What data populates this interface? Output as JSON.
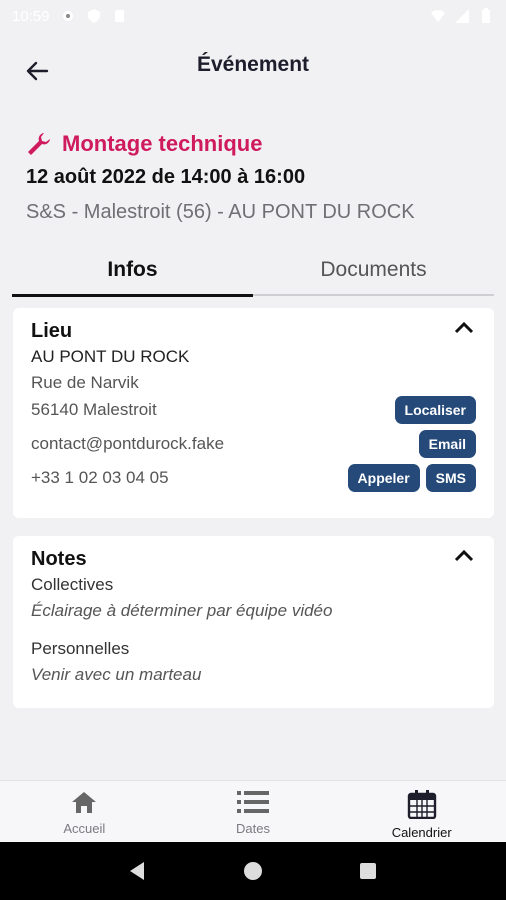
{
  "status_bar": {
    "time": "10:59",
    "icons": [
      "gear-icon",
      "shield-icon",
      "sd-card-icon",
      "wifi-icon",
      "signal-icon",
      "battery-icon"
    ]
  },
  "header": {
    "title": "Événement",
    "back_icon": "arrow-left-icon"
  },
  "event": {
    "type_icon": "wrench-icon",
    "type": "Montage technique",
    "date": "12 août 2022 de 14:00 à 16:00",
    "place": "S&S - Malestroit (56) - AU PONT DU ROCK"
  },
  "tabs": [
    {
      "label": "Infos",
      "active": true
    },
    {
      "label": "Documents",
      "active": false
    }
  ],
  "lieu": {
    "title": "Lieu",
    "name": "AU PONT DU ROCK",
    "street": "Rue de Narvik",
    "city": "56140 Malestroit",
    "email": "contact@pontdurock.fake",
    "phone": "+33 1 02 03 04 05",
    "buttons": {
      "localiser": "Localiser",
      "email": "Email",
      "appeler": "Appeler",
      "sms": "SMS"
    }
  },
  "notes": {
    "title": "Notes",
    "collectives_label": "Collectives",
    "collectives_text": "Éclairage à déterminer par équipe vidéo",
    "personnelles_label": "Personnelles",
    "personnelles_text": "Venir avec un marteau"
  },
  "bottom_nav": [
    {
      "label": "Accueil",
      "icon": "home-icon",
      "active": false
    },
    {
      "label": "Dates",
      "icon": "list-icon",
      "active": false
    },
    {
      "label": "Calendrier",
      "icon": "calendar-icon",
      "active": true
    }
  ],
  "colors": {
    "accent": "#cf1a5d",
    "button": "#254a7a",
    "background": "#f1f1f3"
  }
}
